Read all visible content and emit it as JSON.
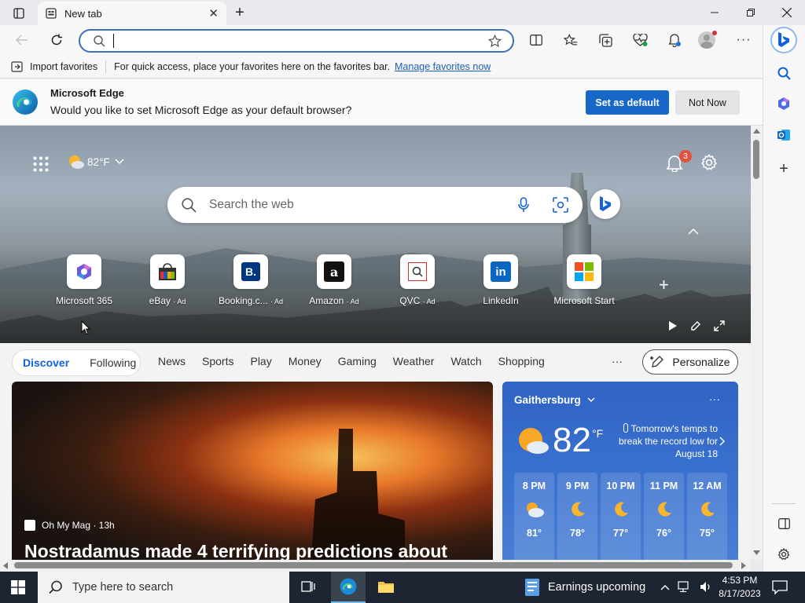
{
  "tab": {
    "title": "New tab"
  },
  "address": {
    "value": ""
  },
  "favorites_bar": {
    "import_label": "Import favorites",
    "message": "For quick access, place your favorites here on the favorites bar.",
    "manage_link": "Manage favorites now"
  },
  "infobar": {
    "title": "Microsoft Edge",
    "message": "Would you like to set Microsoft Edge as your default browser?",
    "primary_button": "Set as default",
    "secondary_button": "Not Now"
  },
  "hero": {
    "temperature": "82°F",
    "notification_count": "3",
    "search_placeholder": "Search the web"
  },
  "quick_links": [
    {
      "label": "Microsoft 365",
      "ad": ""
    },
    {
      "label": "eBay",
      "ad": "· Ad"
    },
    {
      "label": "Booking.c...",
      "ad": "· Ad"
    },
    {
      "label": "Amazon",
      "ad": "· Ad"
    },
    {
      "label": "QVC",
      "ad": "· Ad"
    },
    {
      "label": "LinkedIn",
      "ad": ""
    },
    {
      "label": "Microsoft Start",
      "ad": ""
    }
  ],
  "nav": {
    "discover": "Discover",
    "following": "Following",
    "items": [
      "News",
      "Sports",
      "Play",
      "Money",
      "Gaming",
      "Weather",
      "Watch",
      "Shopping"
    ],
    "more": "···",
    "personalize": "Personalize"
  },
  "news": {
    "source": "Oh My Mag · 13h",
    "headline": "Nostradamus made 4 terrifying predictions about"
  },
  "weather": {
    "location": "Gaithersburg",
    "temp": "82",
    "unit": "°F",
    "tip": "Tomorrow's temps to break the record low for August 18",
    "more": "···",
    "hourly": [
      {
        "time": "8 PM",
        "temp": "81°"
      },
      {
        "time": "9 PM",
        "temp": "78°"
      },
      {
        "time": "10 PM",
        "temp": "77°"
      },
      {
        "time": "11 PM",
        "temp": "76°"
      },
      {
        "time": "12 AM",
        "temp": "75°"
      }
    ]
  },
  "taskbar": {
    "search_placeholder": "Type here to search",
    "news_widget": "Earnings upcoming",
    "time": "4:53 PM",
    "date": "8/17/2023"
  },
  "colors": {
    "accent": "#1767c9",
    "weather_bg": "#3068c8",
    "taskbar": "#1c2531"
  }
}
